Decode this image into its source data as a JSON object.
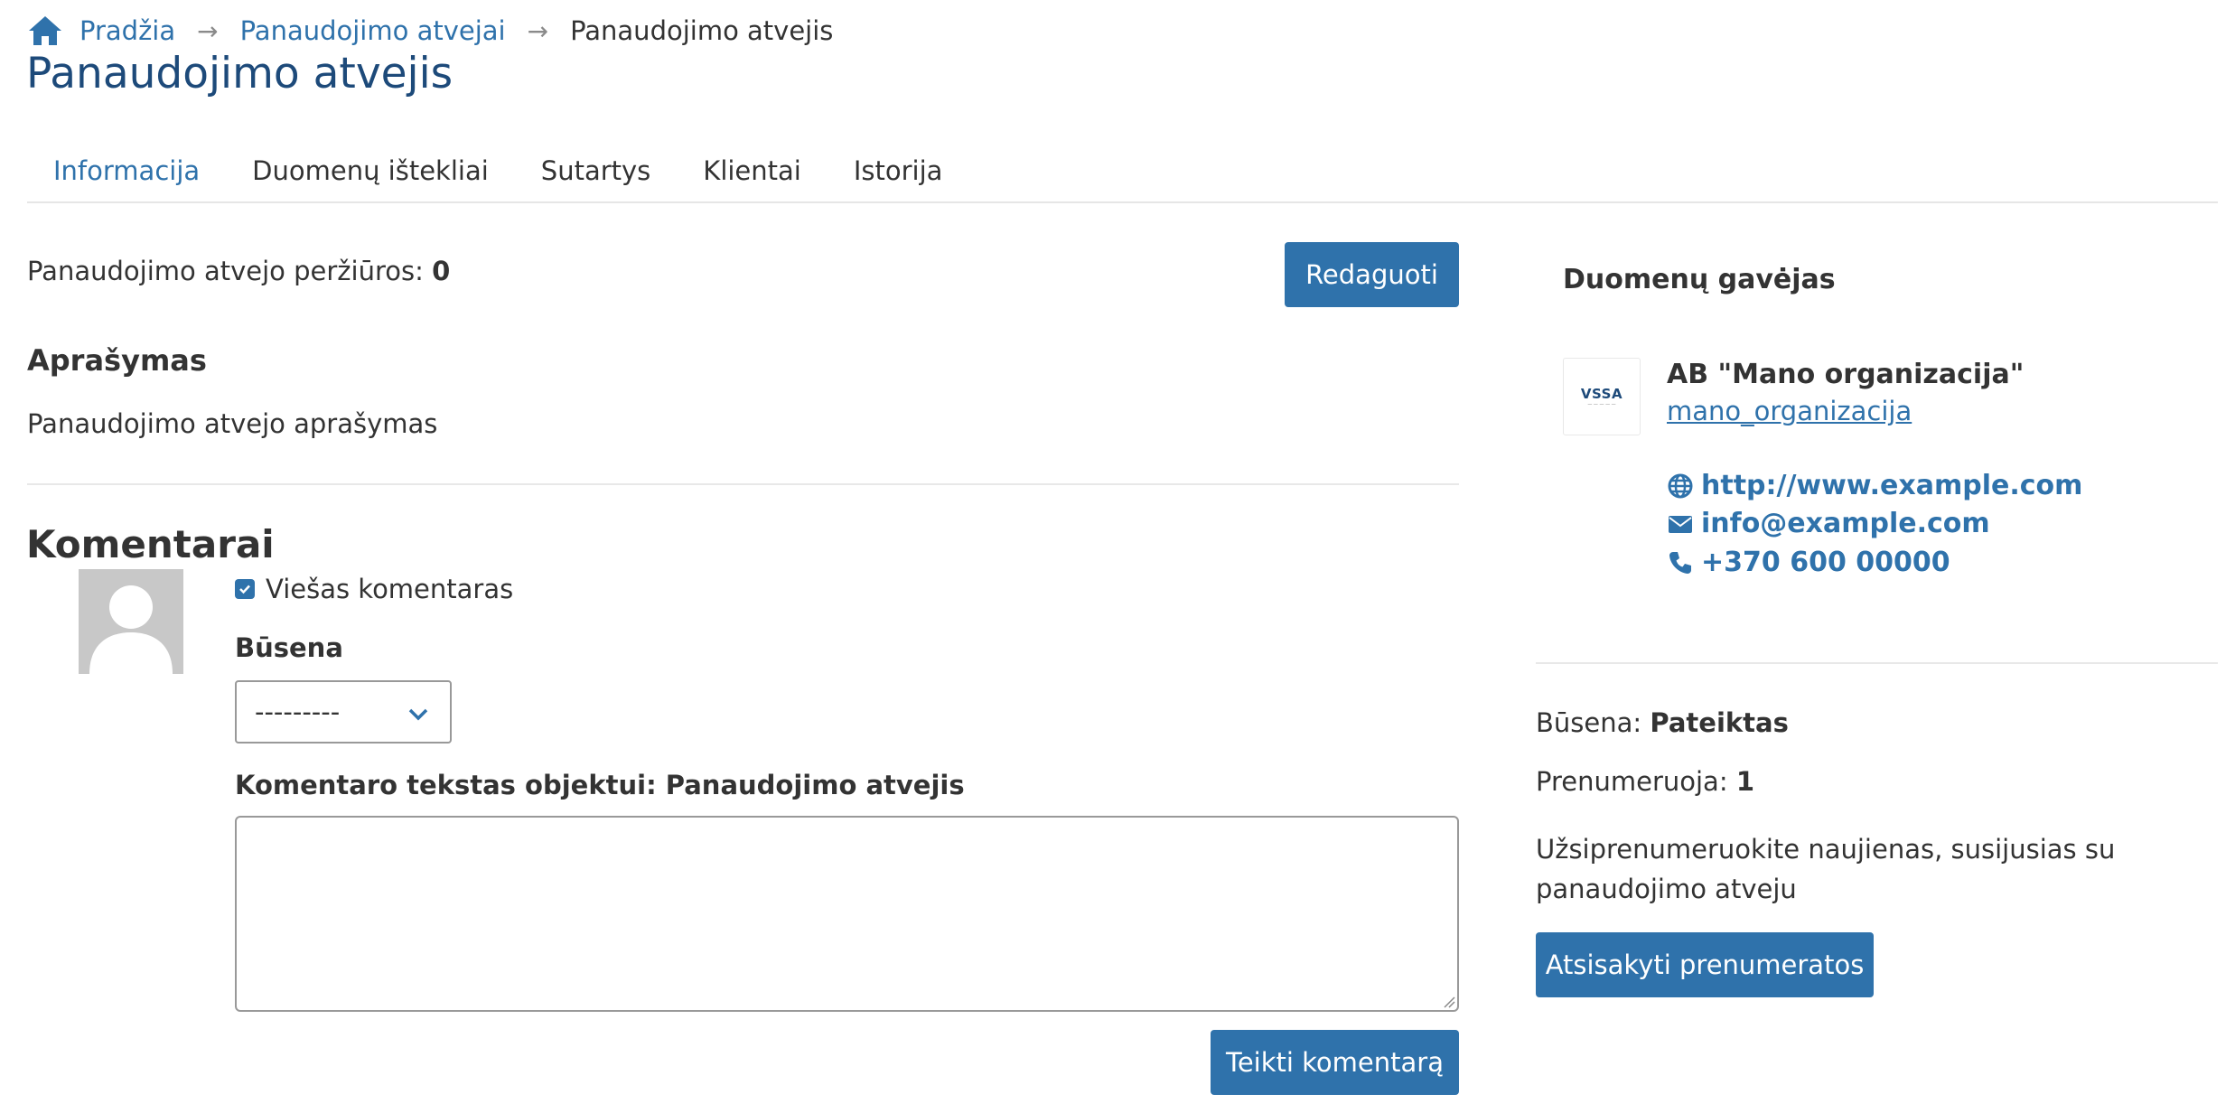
{
  "breadcrumb": {
    "home": "Pradžia",
    "list": "Panaudojimo atvejai",
    "current": "Panaudojimo atvejis"
  },
  "page_title": "Panaudojimo atvejis",
  "tabs": [
    {
      "label": "Informacija",
      "active": true
    },
    {
      "label": "Duomenų ištekliai",
      "active": false
    },
    {
      "label": "Sutartys",
      "active": false
    },
    {
      "label": "Klientai",
      "active": false
    },
    {
      "label": "Istorija",
      "active": false
    }
  ],
  "views": {
    "label": "Panaudojimo atvejo peržiūros:",
    "count": "0"
  },
  "edit_button": "Redaguoti",
  "description": {
    "heading": "Aprašymas",
    "text": "Panaudojimo atvejo aprašymas"
  },
  "comments": {
    "heading": "Komentarai",
    "public_checkbox": {
      "label": "Viešas komentaras",
      "checked": true
    },
    "status_label": "Būsena",
    "status_value": "---------",
    "text_label": "Komentaro tekstas objektui: Panaudojimo atvejis",
    "text_value": "",
    "submit": "Teikti komentarą"
  },
  "recipient": {
    "heading": "Duomenų gavėjas",
    "logo_text": "VSSA",
    "org_name": "AB \"Mano organizacija\"",
    "org_username": "mano_organizacija",
    "website": "http://www.example.com",
    "email": "info@example.com",
    "phone": "+370 600 00000"
  },
  "subscription": {
    "status_label": "Būsena:",
    "status_value": "Pateiktas",
    "subscribers_label": "Prenumeruoja:",
    "subscribers_value": "1",
    "info": "Užsiprenumeruokite naujienas, susijusias su panaudojimo atveju",
    "unsubscribe": "Atsisakyti prenumeratos"
  },
  "colors": {
    "accent": "#2f72ab",
    "title": "#1d4a7a"
  }
}
